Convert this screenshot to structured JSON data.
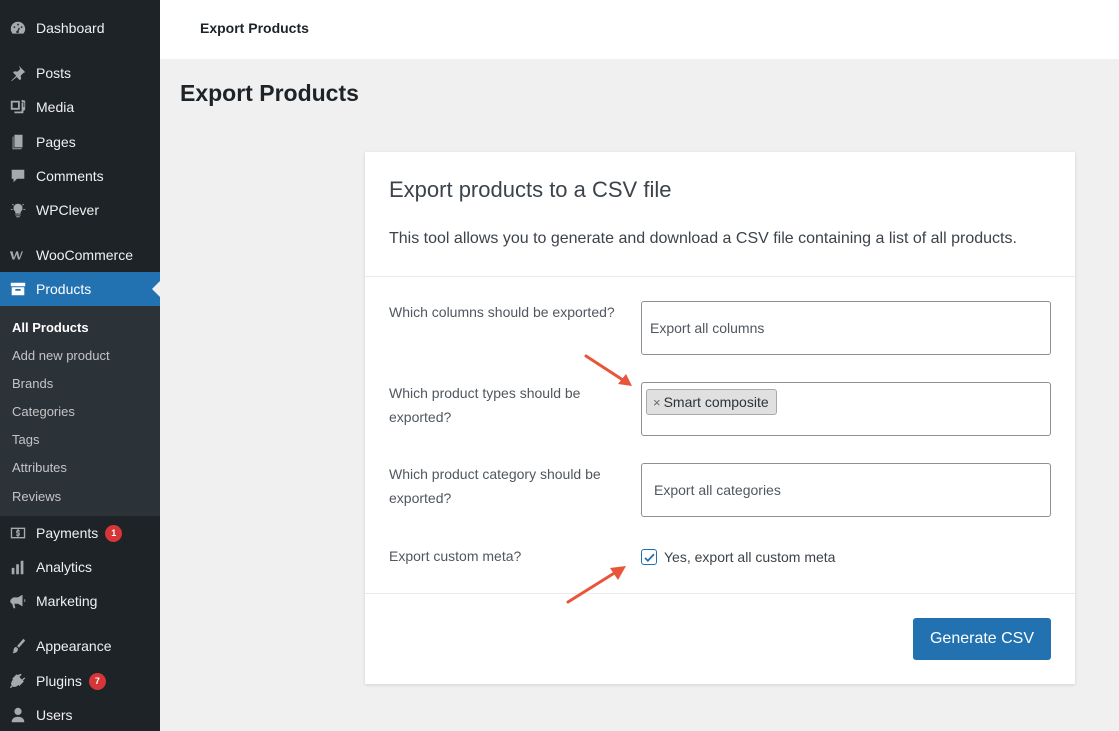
{
  "sidebar": {
    "items": [
      {
        "label": "Dashboard",
        "icon": "dashboard-icon"
      },
      {
        "label": "Posts",
        "icon": "pin-icon"
      },
      {
        "label": "Media",
        "icon": "media-icon"
      },
      {
        "label": "Pages",
        "icon": "pages-icon"
      },
      {
        "label": "Comments",
        "icon": "comment-icon"
      },
      {
        "label": "WPClever",
        "icon": "lightbulb-icon"
      },
      {
        "label": "WooCommerce",
        "icon": "woo-icon"
      },
      {
        "label": "Products",
        "icon": "archive-icon"
      },
      {
        "label": "Payments",
        "icon": "payments-icon",
        "badge": "1"
      },
      {
        "label": "Analytics",
        "icon": "chart-bar-icon"
      },
      {
        "label": "Marketing",
        "icon": "megaphone-icon"
      },
      {
        "label": "Appearance",
        "icon": "brush-icon"
      },
      {
        "label": "Plugins",
        "icon": "plugin-icon",
        "badge": "7"
      },
      {
        "label": "Users",
        "icon": "user-icon"
      }
    ],
    "submenu": [
      "All Products",
      "Add new product",
      "Brands",
      "Categories",
      "Tags",
      "Attributes",
      "Reviews"
    ]
  },
  "topbar": {
    "title": "Export Products"
  },
  "page": {
    "title": "Export Products"
  },
  "card": {
    "title": "Export products to a CSV file",
    "description": "This tool allows you to generate and download a CSV file containing a list of all products.",
    "fields": {
      "columns_label": "Which columns should be exported?",
      "columns_placeholder": "Export all columns",
      "types_label": "Which product types should be exported?",
      "types_tag": "Smart composite",
      "category_label": "Which product category should be exported?",
      "category_placeholder": "Export all categories",
      "meta_label": "Export custom meta?",
      "meta_checkbox_label": "Yes, export all custom meta"
    },
    "button": "Generate CSV"
  },
  "colors": {
    "accent": "#2271b1",
    "sidebar": "#1d2327",
    "arrow": "#e8553b"
  }
}
